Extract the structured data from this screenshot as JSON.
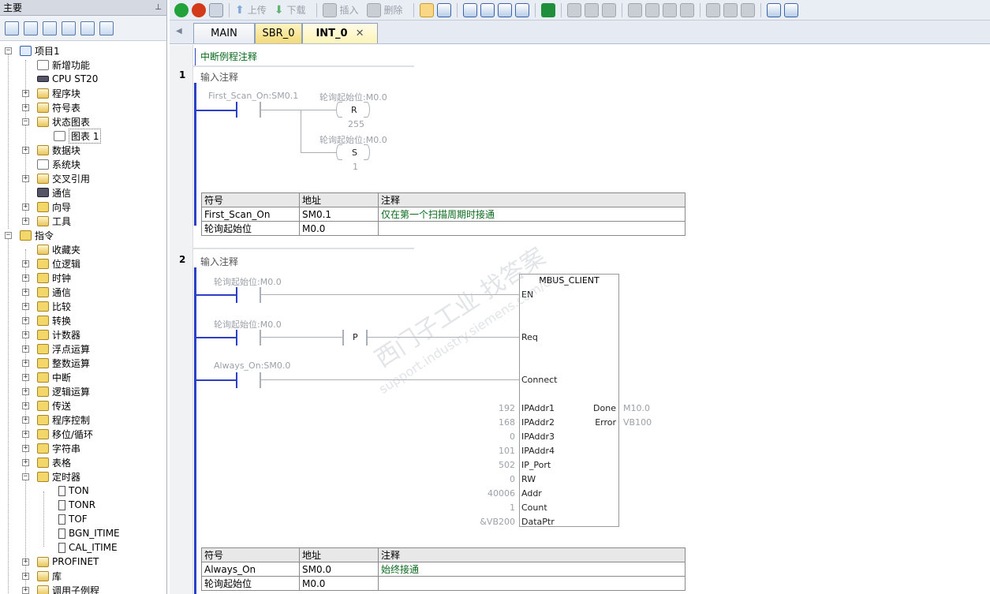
{
  "left_pane": {
    "title": "主要"
  },
  "tree": {
    "project": "项目1",
    "items": [
      "新增功能",
      "CPU ST20",
      "程序块",
      "符号表",
      "状态图表",
      "图表 1",
      "数据块",
      "系统块",
      "交叉引用",
      "通信",
      "向导",
      "工具"
    ],
    "instructions": "指令",
    "instr_items": [
      "收藏夹",
      "位逻辑",
      "时钟",
      "通信",
      "比较",
      "转换",
      "计数器",
      "浮点运算",
      "整数运算",
      "中断",
      "逻辑运算",
      "传送",
      "程序控制",
      "移位/循环",
      "字符串",
      "表格",
      "定时器",
      "PROFINET",
      "库",
      "调用子例程"
    ],
    "timers": [
      "TON",
      "TONR",
      "TOF",
      "BGN_ITIME",
      "CAL_ITIME"
    ]
  },
  "toolbar": {
    "upload": "上传",
    "download": "下载",
    "insert": "插入",
    "delete": "删除"
  },
  "tabs": [
    "MAIN",
    "SBR_0",
    "INT_0"
  ],
  "editor": {
    "program_comment": "中断例程注释"
  },
  "symtable": {
    "headers": [
      "符号",
      "地址",
      "注释"
    ]
  },
  "networks": [
    {
      "number": "1",
      "comment": "输入注释",
      "contact": "First_Scan_On:SM0.1",
      "coil_r": {
        "operand": "轮询起始位:M0.0",
        "type": "R",
        "count": "255"
      },
      "coil_s": {
        "operand": "轮询起始位:M0.0",
        "type": "S",
        "count": "1"
      },
      "symbols": [
        {
          "symbol": "First_Scan_On",
          "address": "SM0.1",
          "comment": "仅在第一个扫描周期时接通"
        },
        {
          "symbol": "轮询起始位",
          "address": "M0.0",
          "comment": ""
        }
      ]
    },
    {
      "number": "2",
      "comment": "输入注释",
      "contacts": [
        "轮询起始位:M0.0",
        "轮询起始位:M0.0",
        "Always_On:SM0.0"
      ],
      "edge": "P",
      "block": {
        "name": "MBUS_CLIENT",
        "inputs": [
          "EN",
          "Req",
          "Connect"
        ],
        "params": [
          {
            "name": "IPAddr1",
            "value": "192"
          },
          {
            "name": "IPAddr2",
            "value": "168"
          },
          {
            "name": "IPAddr3",
            "value": "0"
          },
          {
            "name": "IPAddr4",
            "value": "101"
          },
          {
            "name": "IP_Port",
            "value": "502"
          },
          {
            "name": "RW",
            "value": "0"
          },
          {
            "name": "Addr",
            "value": "40006"
          },
          {
            "name": "Count",
            "value": "1"
          },
          {
            "name": "DataPtr",
            "value": "&VB200"
          }
        ],
        "outputs": [
          {
            "name": "Done",
            "value": "M10.0"
          },
          {
            "name": "Error",
            "value": "VB100"
          }
        ]
      },
      "symbols": [
        {
          "symbol": "Always_On",
          "address": "SM0.0",
          "comment": "始终接通"
        },
        {
          "symbol": "轮询起始位",
          "address": "M0.0",
          "comment": ""
        }
      ]
    }
  ],
  "watermark": {
    "line1": "西门子工业 找答案",
    "line2": "support.industry.siemens.com/cs"
  }
}
